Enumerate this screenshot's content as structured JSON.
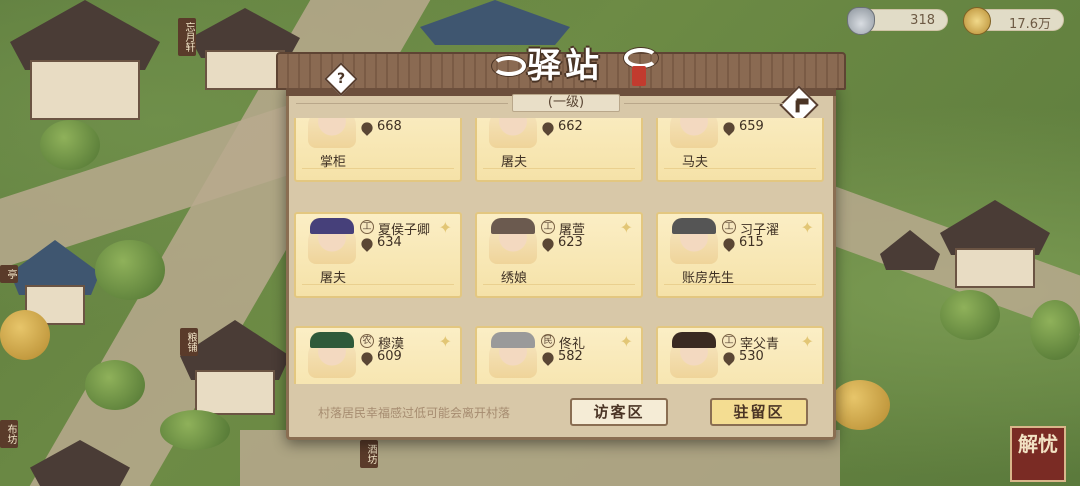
{
  "resources": {
    "silver": {
      "icon": "silver-ingot-icon",
      "value": "318"
    },
    "coins": {
      "icon": "copper-coin-icon",
      "value": "17.6万"
    }
  },
  "panel": {
    "title": "驿站",
    "level": "(一级)",
    "help_icon": "question-icon",
    "build_icon": "hammer-icon"
  },
  "cards": [
    {
      "name": "",
      "score": "668",
      "role": "掌柜",
      "badge": ""
    },
    {
      "name": "",
      "score": "662",
      "role": "屠夫",
      "badge": ""
    },
    {
      "name": "",
      "score": "659",
      "role": "马夫",
      "badge": ""
    },
    {
      "name": "夏侯子卿",
      "score": "634",
      "role": "屠夫",
      "badge": "工"
    },
    {
      "name": "屠萱",
      "score": "623",
      "role": "绣娘",
      "badge": "工"
    },
    {
      "name": "习子濯",
      "score": "615",
      "role": "账房先生",
      "badge": "工"
    },
    {
      "name": "穆漠",
      "score": "609",
      "role": "",
      "badge": "农"
    },
    {
      "name": "佟礼",
      "score": "582",
      "role": "",
      "badge": "民"
    },
    {
      "name": "宰父青",
      "score": "530",
      "role": "",
      "badge": "工"
    }
  ],
  "footer": {
    "message": "村落居民幸福感过低可能会离开村落",
    "visitor_button": "访客区",
    "resident_button": "驻留区"
  },
  "map_signs": [
    "忘月轩",
    "粮铺",
    "酒坊",
    "布坊",
    "亭"
  ],
  "corner_button": "解忧",
  "colors": {
    "accent": "#8a6e52",
    "card": "#fbeec5",
    "resident_button": "#f4dd92"
  }
}
